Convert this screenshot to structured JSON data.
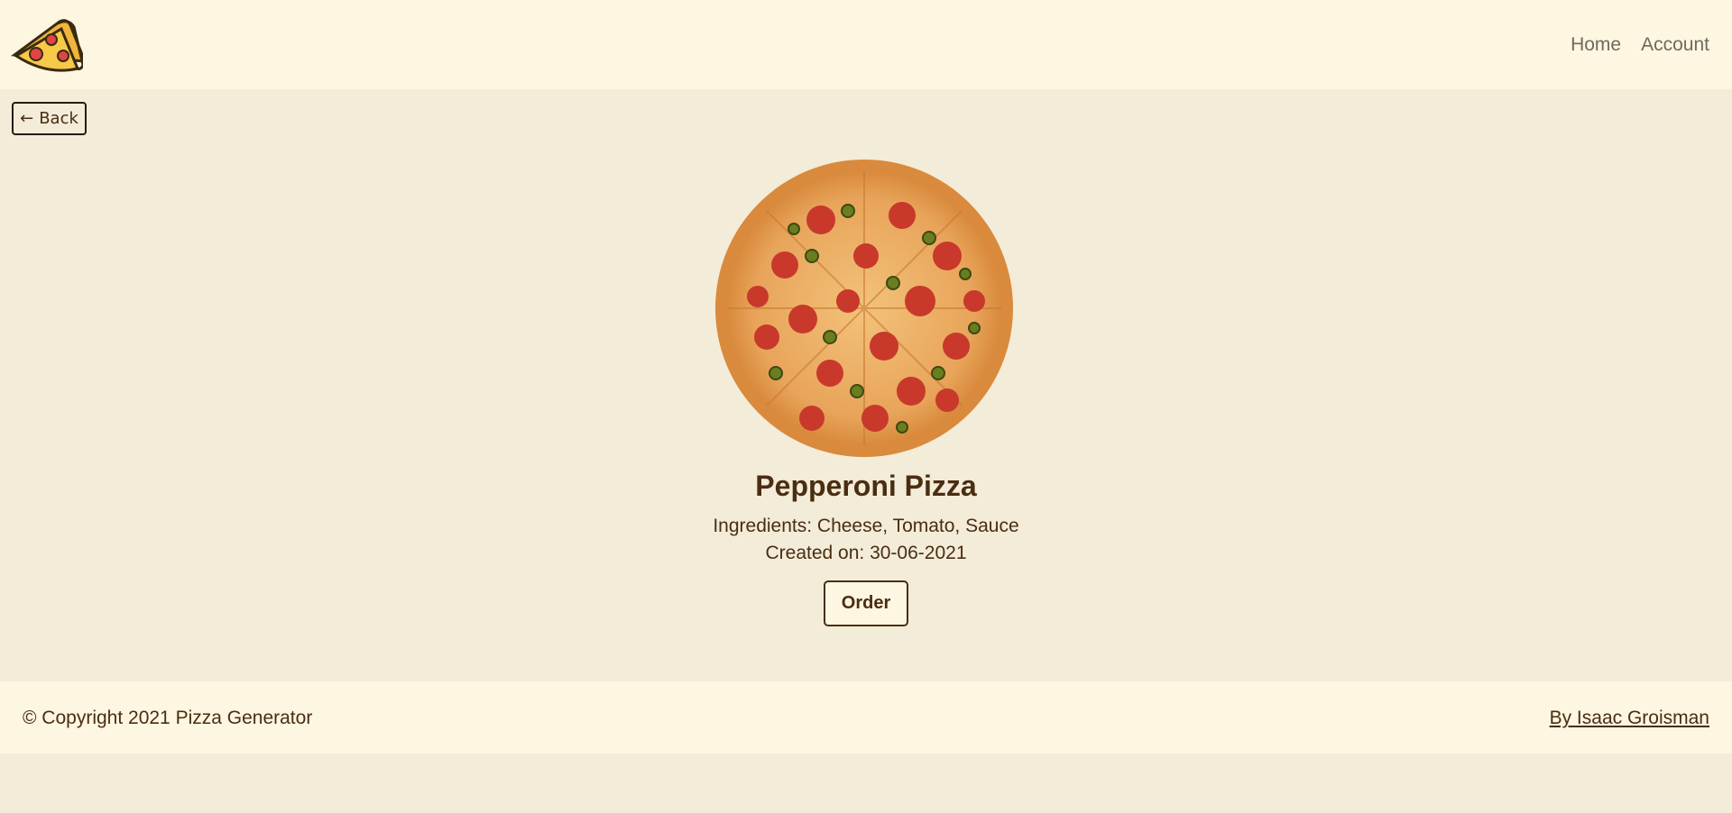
{
  "header": {
    "logo_icon": "pizza-slice-icon",
    "nav": [
      {
        "label": "Home"
      },
      {
        "label": "Account"
      }
    ]
  },
  "back_button": {
    "arrow": "←",
    "label": "Back"
  },
  "pizza": {
    "image_icon": "pepperoni-pizza-image",
    "name": "Pepperoni Pizza",
    "ingredients_text": "Ingredients: Cheese, Tomato, Sauce",
    "created_text": "Created on: 30-06-2021",
    "order_label": "Order"
  },
  "footer": {
    "copyright": "© Copyright 2021 Pizza Generator",
    "author_link": "By Isaac Groisman"
  },
  "colors": {
    "page_bg": "#f3ecd9",
    "bar_bg": "#fdf6e0",
    "text_brown": "#4a2d12",
    "nav_gray": "#6e6a5e"
  }
}
